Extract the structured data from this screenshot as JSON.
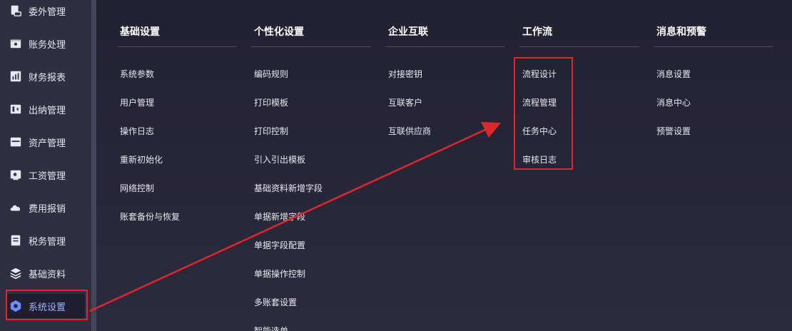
{
  "sidebar": {
    "items": [
      {
        "label": "委外管理",
        "icon": "outsource-icon"
      },
      {
        "label": "账务处理",
        "icon": "ledger-icon"
      },
      {
        "label": "财务报表",
        "icon": "report-icon"
      },
      {
        "label": "出纳管理",
        "icon": "cashier-icon"
      },
      {
        "label": "资产管理",
        "icon": "asset-icon"
      },
      {
        "label": "工资管理",
        "icon": "salary-icon"
      },
      {
        "label": "费用报销",
        "icon": "expense-icon"
      },
      {
        "label": "税务管理",
        "icon": "tax-icon"
      },
      {
        "label": "基础资料",
        "icon": "layers-icon"
      },
      {
        "label": "系统设置",
        "icon": "settings-hexagon-icon",
        "active": true
      }
    ]
  },
  "menu": {
    "columns": [
      {
        "title": "基础设置",
        "links": [
          "系统参数",
          "用户管理",
          "操作日志",
          "重新初始化",
          "网络控制",
          "账套备份与恢复"
        ]
      },
      {
        "title": "个性化设置",
        "links": [
          "编码规则",
          "打印模板",
          "打印控制",
          "引入引出模板",
          "基础资料新增字段",
          "单据新增字段",
          "单据字段配置",
          "单据操作控制",
          "多账套设置",
          "智能选单"
        ]
      },
      {
        "title": "企业互联",
        "links": [
          "对接密钥",
          "互联客户",
          "互联供应商"
        ]
      },
      {
        "title": "工作流",
        "links": [
          "流程设计",
          "流程管理",
          "任务中心",
          "审核日志"
        ]
      },
      {
        "title": "消息和预警",
        "links": [
          "消息设置",
          "消息中心",
          "预警设置"
        ]
      }
    ]
  },
  "colors": {
    "annotation": "#e0262d",
    "active_accent": "#6d8cff"
  }
}
